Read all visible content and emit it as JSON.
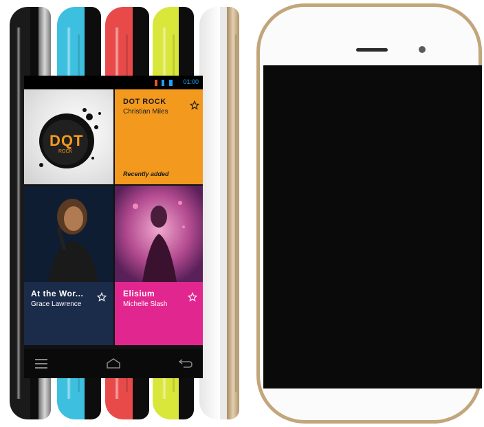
{
  "phones_side": [
    {
      "color": "#1a1a1a",
      "rim": "#9a9a9a"
    },
    {
      "color": "#3dbfe0",
      "rim": "#1a1a1a"
    },
    {
      "color": "#e84a4a",
      "rim": "#1a1a1a"
    },
    {
      "color": "#d9e63a",
      "rim": "#1a1a1a"
    },
    {
      "color": "#f4f4f4",
      "rim": "#c2a57b"
    }
  ],
  "status": {
    "time": "01:00"
  },
  "tiles": [
    {
      "title": "DOT ROCK",
      "artist": "Christian Miles",
      "note": "Recently added",
      "color": "#f39a1e",
      "art_text": "DQT",
      "art_sub": "ROCK"
    },
    {
      "title": "At the Wor...",
      "artist": "Grace Lawrence",
      "color": "#1b2c4a"
    },
    {
      "title": "Elisium",
      "artist": "Michelle Slash",
      "color": "#e2268f"
    }
  ],
  "icons": {
    "star": "star-icon",
    "menu": "menu-icon",
    "home": "home-icon",
    "back": "back-icon"
  }
}
